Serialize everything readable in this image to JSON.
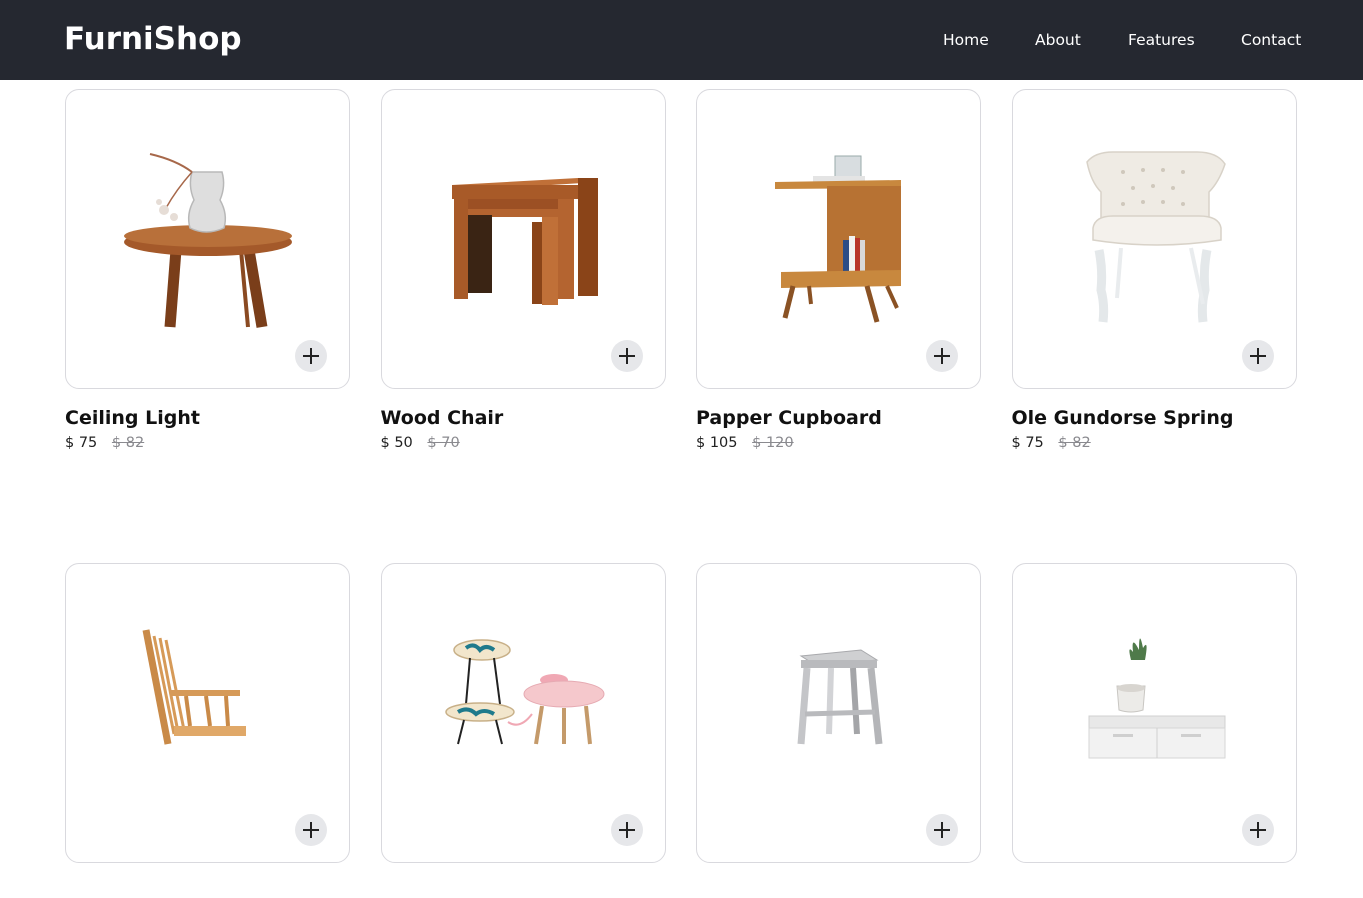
{
  "brand": "FurniShop",
  "nav": {
    "home": "Home",
    "about": "About",
    "features": "Features",
    "contact": "Contact"
  },
  "products": [
    {
      "name": "Ceiling Light",
      "price": "$ 75",
      "old_price": "$ 82"
    },
    {
      "name": "Wood Chair",
      "price": "$ 50",
      "old_price": "$ 70"
    },
    {
      "name": "Papper Cupboard",
      "price": "$ 105",
      "old_price": "$ 120"
    },
    {
      "name": "Ole Gundorse Spring",
      "price": "$ 75",
      "old_price": "$ 82"
    },
    {
      "name": "",
      "price": "",
      "old_price": ""
    },
    {
      "name": "",
      "price": "",
      "old_price": ""
    },
    {
      "name": "",
      "price": "",
      "old_price": ""
    },
    {
      "name": "",
      "price": "",
      "old_price": ""
    }
  ],
  "icons": {
    "add": "plus-icon"
  },
  "colors": {
    "navbar": "#252830",
    "card_border": "#d9d9de",
    "add_button": "#e6e7ea",
    "old_price": "#8a8a8f"
  }
}
